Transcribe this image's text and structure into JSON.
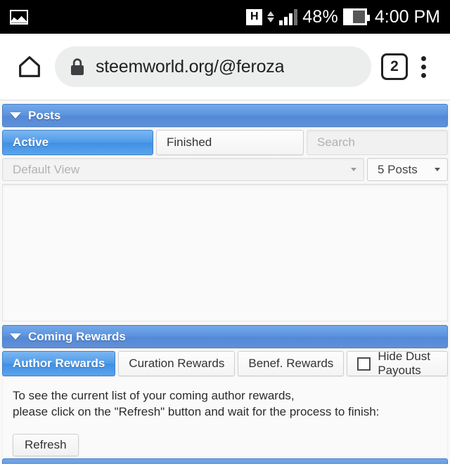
{
  "statusbar": {
    "notification_icon": "image-icon",
    "network_type": "H",
    "data_arrows_icon": "data-transfer-icon",
    "signal_icon": "signal-bars-icon",
    "battery_percent": "48%",
    "battery_icon": "battery-icon",
    "time": "4:00 PM"
  },
  "browser": {
    "home_icon": "home-icon",
    "lock_icon": "lock-icon",
    "url": "steemworld.org/@feroza",
    "tab_count": "2",
    "menu_icon": "overflow-menu-icon"
  },
  "posts_panel": {
    "collapse_icon": "caret-down-icon",
    "title": "Posts",
    "tabs": [
      {
        "label": "Active",
        "active": true
      },
      {
        "label": "Finished",
        "active": false
      }
    ],
    "search_placeholder": "Search",
    "view_select": {
      "value": "Default View",
      "caret_icon": "caret-down-icon"
    },
    "count_select": {
      "value": "5 Posts",
      "caret_icon": "caret-down-icon"
    }
  },
  "rewards_panel": {
    "collapse_icon": "caret-down-icon",
    "title": "Coming Rewards",
    "tabs": [
      {
        "label": "Author Rewards",
        "active": true
      },
      {
        "label": "Curation Rewards",
        "active": false
      },
      {
        "label": "Benef. Rewards",
        "active": false
      }
    ],
    "hide_dust": {
      "label": "Hide Dust Payouts",
      "checked": false
    },
    "info_line1": "To see the current list of your coming author rewards,",
    "info_line2": "please click on the \"Refresh\" button and wait for the process to finish:",
    "refresh_label": "Refresh"
  },
  "colors": {
    "accent_blue": "#5b92dd",
    "tab_active_blue": "#4f9ae8",
    "statusbar_bg": "#000000",
    "page_bg": "#f8f8f8"
  }
}
